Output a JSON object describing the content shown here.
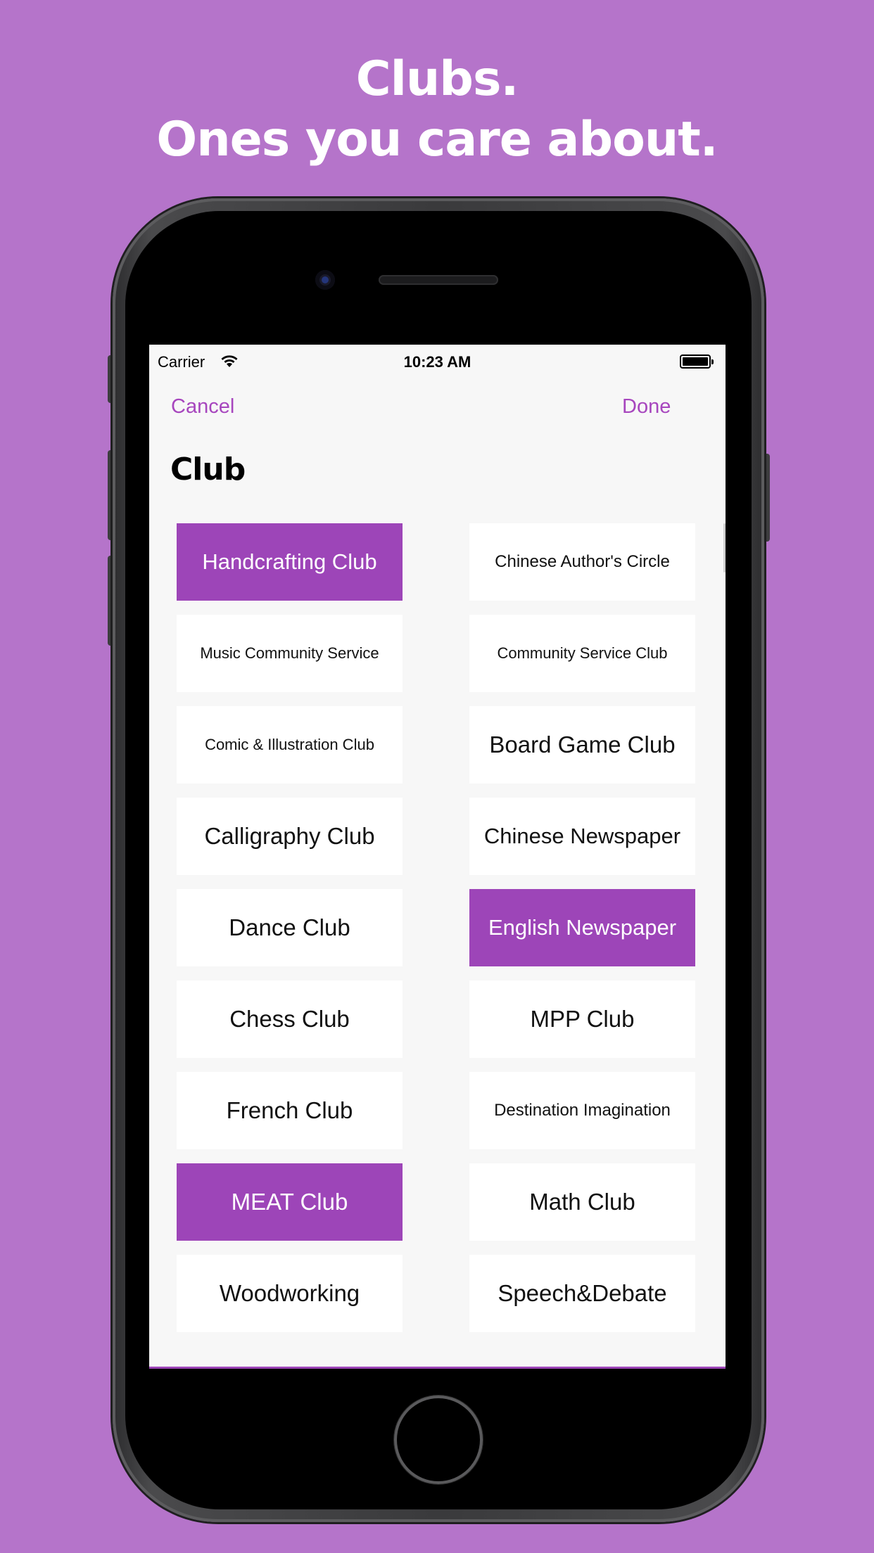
{
  "headline": {
    "line1": "Clubs.",
    "line2": "Ones you care about."
  },
  "status_bar": {
    "carrier": "Carrier",
    "time": "10:23 AM"
  },
  "nav": {
    "cancel_label": "Cancel",
    "done_label": "Done"
  },
  "title": "Club",
  "accent_color": "#9d45b8",
  "background_color": "#b574ca",
  "clubs": [
    {
      "label": "Handcrafting Club",
      "selected": true
    },
    {
      "label": "Chinese Author's Circle",
      "selected": false
    },
    {
      "label": "Music Community Service",
      "selected": false
    },
    {
      "label": "Community Service Club",
      "selected": false
    },
    {
      "label": "Comic & Illustration Club",
      "selected": false
    },
    {
      "label": "Board Game Club",
      "selected": false
    },
    {
      "label": "Calligraphy Club",
      "selected": false
    },
    {
      "label": "Chinese Newspaper",
      "selected": false
    },
    {
      "label": "Dance Club",
      "selected": false
    },
    {
      "label": "English Newspaper",
      "selected": true
    },
    {
      "label": "Chess Club",
      "selected": false
    },
    {
      "label": "MPP Club",
      "selected": false
    },
    {
      "label": "French Club",
      "selected": false
    },
    {
      "label": "Destination Imagination",
      "selected": false
    },
    {
      "label": "MEAT Club",
      "selected": true
    },
    {
      "label": "Math Club",
      "selected": false
    },
    {
      "label": "Woodworking",
      "selected": false
    },
    {
      "label": "Speech&Debate",
      "selected": false
    }
  ]
}
